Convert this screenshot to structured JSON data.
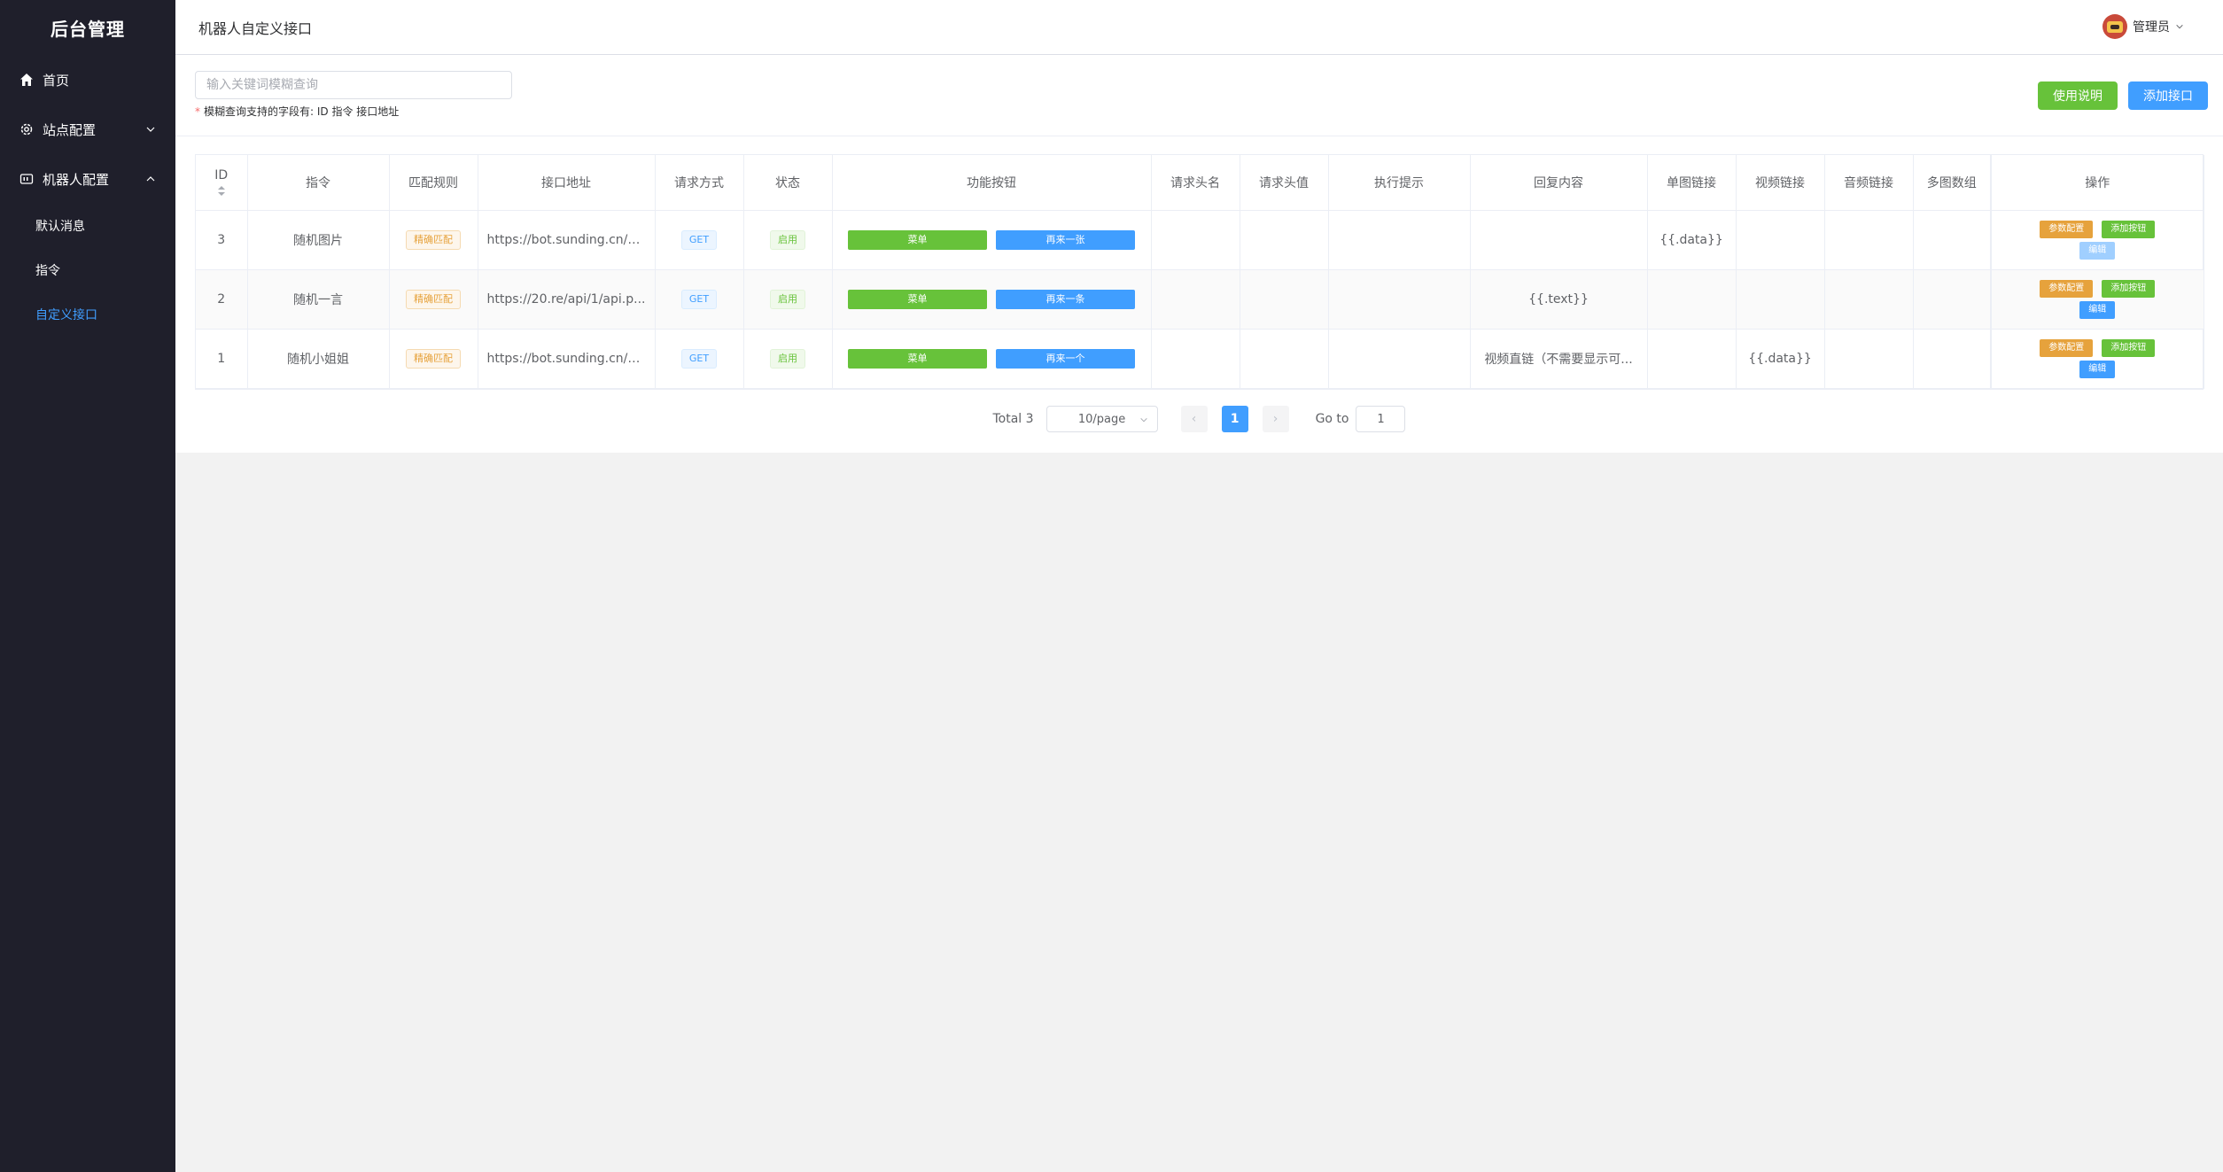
{
  "brand": "后台管理",
  "sidebar": {
    "items": [
      {
        "label": "首页",
        "icon": "home-icon"
      },
      {
        "label": "站点配置",
        "icon": "gear-icon"
      },
      {
        "label": "机器人配置",
        "icon": "robot-icon"
      }
    ],
    "submenu": [
      {
        "label": "默认消息"
      },
      {
        "label": "指令"
      },
      {
        "label": "自定义接口"
      }
    ]
  },
  "header": {
    "title": "机器人自定义接口",
    "user": "管理员"
  },
  "toolbar": {
    "search_placeholder": "输入关键词模糊查询",
    "hint_star": "*",
    "hint": "模糊查询支持的字段有: ID 指令 接口地址",
    "help_label": "使用说明",
    "add_label": "添加接口"
  },
  "table": {
    "columns": [
      "ID",
      "指令",
      "匹配规则",
      "接口地址",
      "请求方式",
      "状态",
      "功能按钮",
      "请求头名",
      "请求头值",
      "执行提示",
      "回复内容",
      "单图链接",
      "视频链接",
      "音频链接",
      "多图数组",
      "操作"
    ],
    "rows": [
      {
        "id": "3",
        "cmd": "随机图片",
        "rule": "精确匹配",
        "url": "https://bot.sunding.cn/s...",
        "method": "GET",
        "status": "启用",
        "btn1": "菜单",
        "btn2": "再来一张",
        "hname": "",
        "hval": "",
        "tip": "",
        "reply": "",
        "img": "{{.data}}",
        "video": "",
        "audio": "",
        "multi": ""
      },
      {
        "id": "2",
        "cmd": "随机一言",
        "rule": "精确匹配",
        "url": "https://20.re/api/1/api.p...",
        "method": "GET",
        "status": "启用",
        "btn1": "菜单",
        "btn2": "再来一条",
        "hname": "",
        "hval": "",
        "tip": "",
        "reply": "{{.text}}",
        "img": "",
        "video": "",
        "audio": "",
        "multi": ""
      },
      {
        "id": "1",
        "cmd": "随机小姐姐",
        "rule": "精确匹配",
        "url": "https://bot.sunding.cn/s...",
        "method": "GET",
        "status": "启用",
        "btn1": "菜单",
        "btn2": "再来一个",
        "hname": "",
        "hval": "",
        "tip": "",
        "reply": "视频直链（不需要显示可...",
        "img": "",
        "video": "{{.data}}",
        "audio": "",
        "multi": ""
      }
    ],
    "ops": {
      "param": "参数配置",
      "addbtn": "添加按钮",
      "edit": "编辑"
    }
  },
  "pagination": {
    "total": "Total 3",
    "page_size": "10/page",
    "current": "1",
    "goto_label": "Go to",
    "goto_value": "1",
    "prev": "‹",
    "next": "›"
  },
  "colors": {
    "sidebar_bg": "#1f1f2b",
    "primary": "#409eff",
    "success": "#67c23a",
    "warning": "#e6a23c"
  }
}
